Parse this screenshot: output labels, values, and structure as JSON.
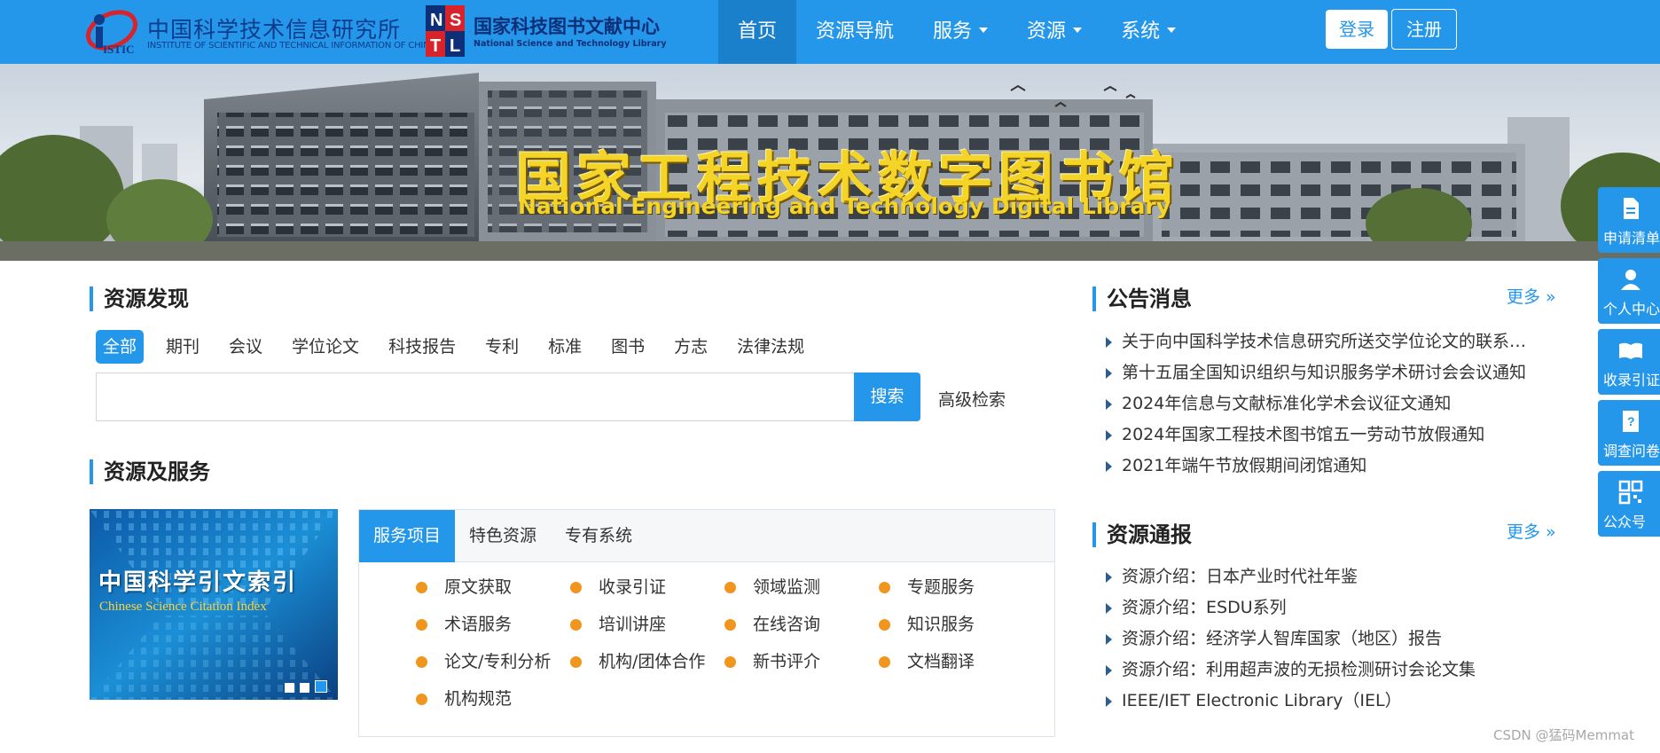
{
  "header": {
    "logo1": {
      "cn": "中国科学技术信息研究所",
      "en": "INSTITUTE OF SCIENTIFIC AND TECHNICAL INFORMATION OF CHINA",
      "mark": "ISTIC"
    },
    "logo2": {
      "cn": "国家科技图书文献中心",
      "en": "National Science and Technology Library",
      "mark_letters": [
        "N",
        "S",
        "T",
        "L"
      ]
    },
    "nav": [
      {
        "label": "首页",
        "active": true,
        "dropdown": false
      },
      {
        "label": "资源导航",
        "active": false,
        "dropdown": false
      },
      {
        "label": "服务",
        "active": false,
        "dropdown": true
      },
      {
        "label": "资源",
        "active": false,
        "dropdown": true
      },
      {
        "label": "系统",
        "active": false,
        "dropdown": true
      }
    ],
    "login_label": "登录",
    "register_label": "注册"
  },
  "banner": {
    "title_cn": "国家工程技术数字图书馆",
    "title_en": "National Engineering and Technology Digital Library"
  },
  "discovery": {
    "title": "资源发现",
    "tabs": [
      "全部",
      "期刊",
      "会议",
      "学位论文",
      "科技报告",
      "专利",
      "标准",
      "图书",
      "方志",
      "法律法规"
    ],
    "active_tab": "全部",
    "search_value": "",
    "search_button": "搜索",
    "advanced_search": "高级检索"
  },
  "services": {
    "title": "资源及服务",
    "carousel": {
      "title_cn": "中国科学引文索引",
      "title_en": "Chinese Science Citation Index",
      "slides": 3,
      "active_slide": 3
    },
    "tabs": [
      "服务项目",
      "特色资源",
      "专有系统"
    ],
    "active_tab": "服务项目",
    "items": [
      "原文获取",
      "收录引证",
      "领域监测",
      "专题服务",
      "术语服务",
      "培训讲座",
      "在线咨询",
      "知识服务",
      "论文/专利分析",
      "机构/团体合作",
      "新书评介",
      "文档翻译",
      "机构规范"
    ]
  },
  "announcements": {
    "title": "公告消息",
    "more": "更多 »",
    "items": [
      "关于向中国科学技术信息研究所送交学位论文的联系…",
      "第十五届全国知识组织与知识服务学术研讨会会议通知",
      "2024年信息与文献标准化学术会议征文通知",
      "2024年国家工程技术图书馆五一劳动节放假通知",
      "2021年端午节放假期间闭馆通知"
    ]
  },
  "resource_news": {
    "title": "资源通报",
    "more": "更多 »",
    "items": [
      "资源介绍：日本产业时代社年鉴",
      "资源介绍：ESDU系列",
      "资源介绍：经济学人智库国家（地区）报告",
      "资源介绍：利用超声波的无损检测研讨会论文集",
      "IEEE/IET Electronic Library（IEL）"
    ]
  },
  "sidebar": [
    {
      "label": "申请清单",
      "icon": "document-icon"
    },
    {
      "label": "个人中心",
      "icon": "user-icon"
    },
    {
      "label": "收录引证",
      "icon": "book-icon"
    },
    {
      "label": "调查问卷",
      "icon": "survey-icon"
    },
    {
      "label": "公众号",
      "icon": "qrcode-icon"
    }
  ],
  "watermark": "CSDN @猛码Memmat",
  "colors": {
    "primary": "#2597ea",
    "nav_active": "#1b80cc",
    "bullet": "#f0961e",
    "banner_text": "#f5d428"
  }
}
